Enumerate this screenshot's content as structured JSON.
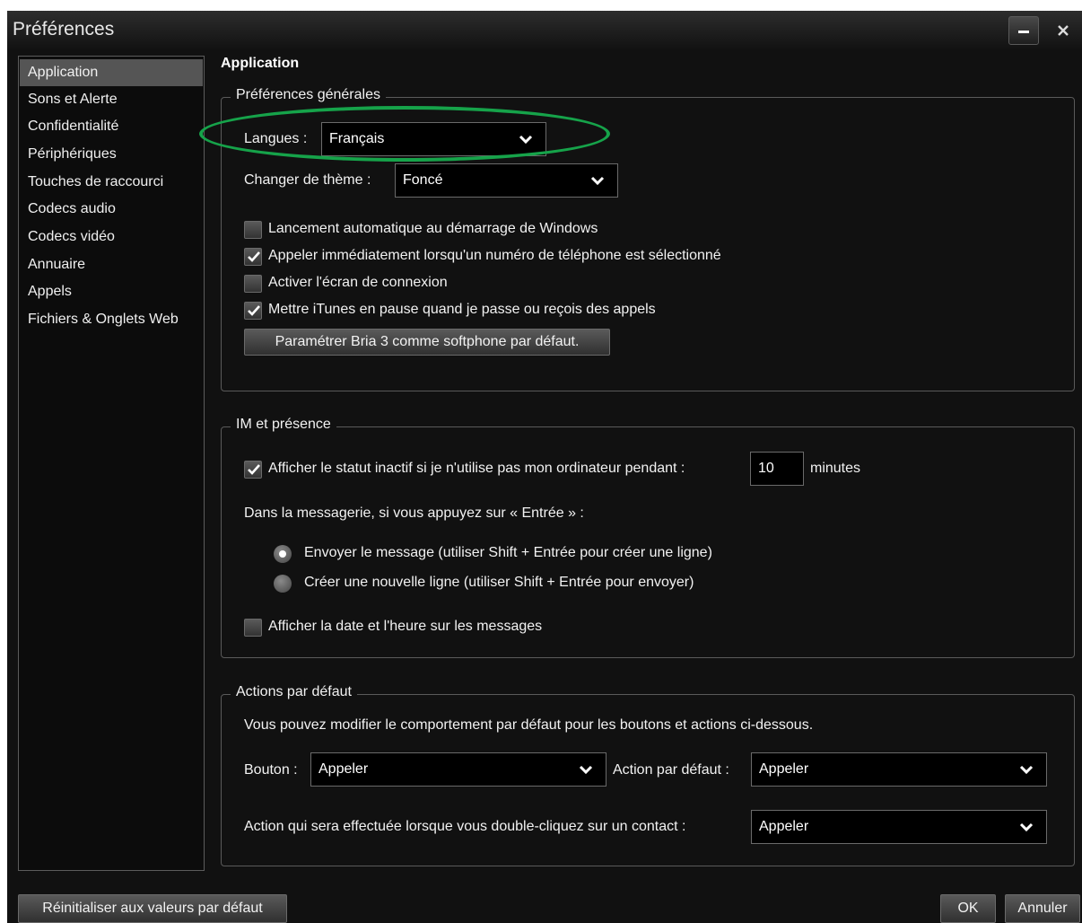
{
  "window": {
    "title": "Préférences",
    "minimize_label": "–",
    "close_label": "×"
  },
  "sidebar": {
    "items": [
      {
        "label": "Application",
        "selected": true
      },
      {
        "label": "Sons et Alerte"
      },
      {
        "label": "Confidentialité"
      },
      {
        "label": "Périphériques"
      },
      {
        "label": "Touches de raccourci"
      },
      {
        "label": "Codecs audio"
      },
      {
        "label": "Codecs vidéo"
      },
      {
        "label": "Annuaire"
      },
      {
        "label": "Appels"
      },
      {
        "label": "Fichiers & Onglets Web"
      }
    ]
  },
  "content": {
    "title": "Application",
    "general": {
      "legend": "Préférences générales",
      "language_label": "Langues :",
      "language_value": "Français",
      "theme_label": "Changer de thème :",
      "theme_value": "Foncé",
      "checks": [
        {
          "label": "Lancement automatique au démarrage de Windows",
          "checked": false
        },
        {
          "label": "Appeler immédiatement lorsqu'un numéro de téléphone est sélectionné",
          "checked": true
        },
        {
          "label": "Activer l'écran de connexion",
          "checked": false
        },
        {
          "label": "Mettre iTunes en pause quand je passe ou reçois des appels",
          "checked": true
        }
      ],
      "softphone_button": "Paramétrer Bria 3 comme softphone par défaut."
    },
    "im": {
      "legend": "IM et présence",
      "idle_label": "Afficher le statut inactif si je n'utilise pas mon ordinateur pendant :",
      "idle_checked": true,
      "idle_value": "10",
      "idle_unit": "minutes",
      "enter_label": "Dans la messagerie, si vous appuyez sur « Entrée » :",
      "radios": [
        {
          "label": "Envoyer le message (utiliser Shift + Entrée pour créer une ligne)",
          "selected": true
        },
        {
          "label": "Créer une nouvelle ligne (utiliser Shift + Entrée pour envoyer)",
          "selected": false
        }
      ],
      "datetime_label": "Afficher la date et l'heure sur les messages",
      "datetime_checked": false
    },
    "actions": {
      "legend": "Actions par défaut",
      "description": "Vous pouvez modifier le comportement par défaut pour les boutons et actions ci-dessous.",
      "button_label": "Bouton :",
      "button_value": "Appeler",
      "default_action_label": "Action par défaut :",
      "default_action_value": "Appeler",
      "dblclick_label": "Action qui sera effectuée lorsque vous double-cliquez sur un contact :",
      "dblclick_value": "Appeler"
    }
  },
  "footer": {
    "reset_button": "Réinitialiser aux valeurs par défaut",
    "ok_button": "OK",
    "cancel_button": "Annuler"
  },
  "colors": {
    "highlight_ellipse": "#16a34a",
    "selected_item": "#555555",
    "background": "#111111"
  }
}
